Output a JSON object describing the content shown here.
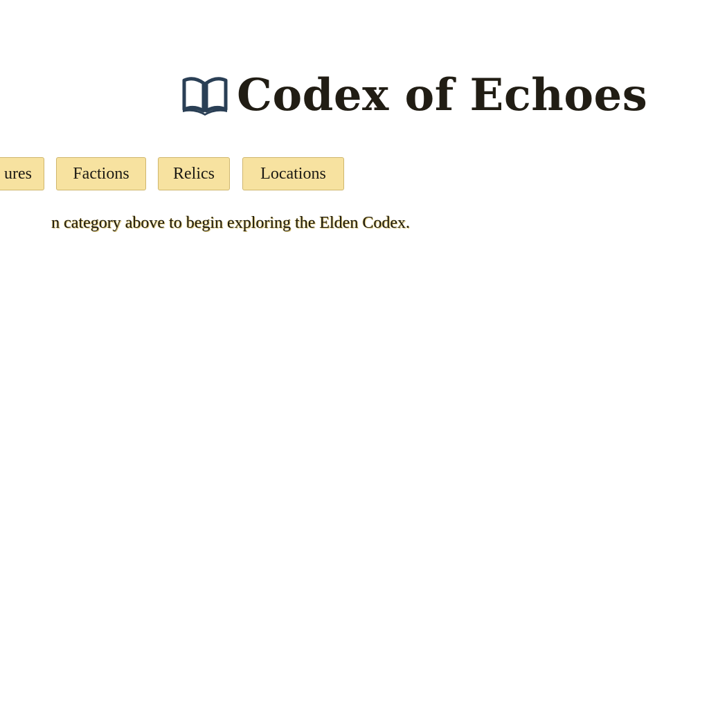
{
  "header": {
    "icon": "book-icon",
    "title": "Codex of Echoes"
  },
  "nav": {
    "buttons": [
      {
        "label": "ures",
        "icon": null
      },
      {
        "label": "Factions"
      },
      {
        "label": "Relics"
      },
      {
        "label": "Locations"
      }
    ]
  },
  "hint": {
    "text": "n category above to begin exploring the Elden Codex."
  },
  "colors": {
    "button_bg": "#f7e2a0",
    "button_border": "#cfb66d",
    "icon_color": "#2a3f55",
    "text": "#211d14"
  }
}
